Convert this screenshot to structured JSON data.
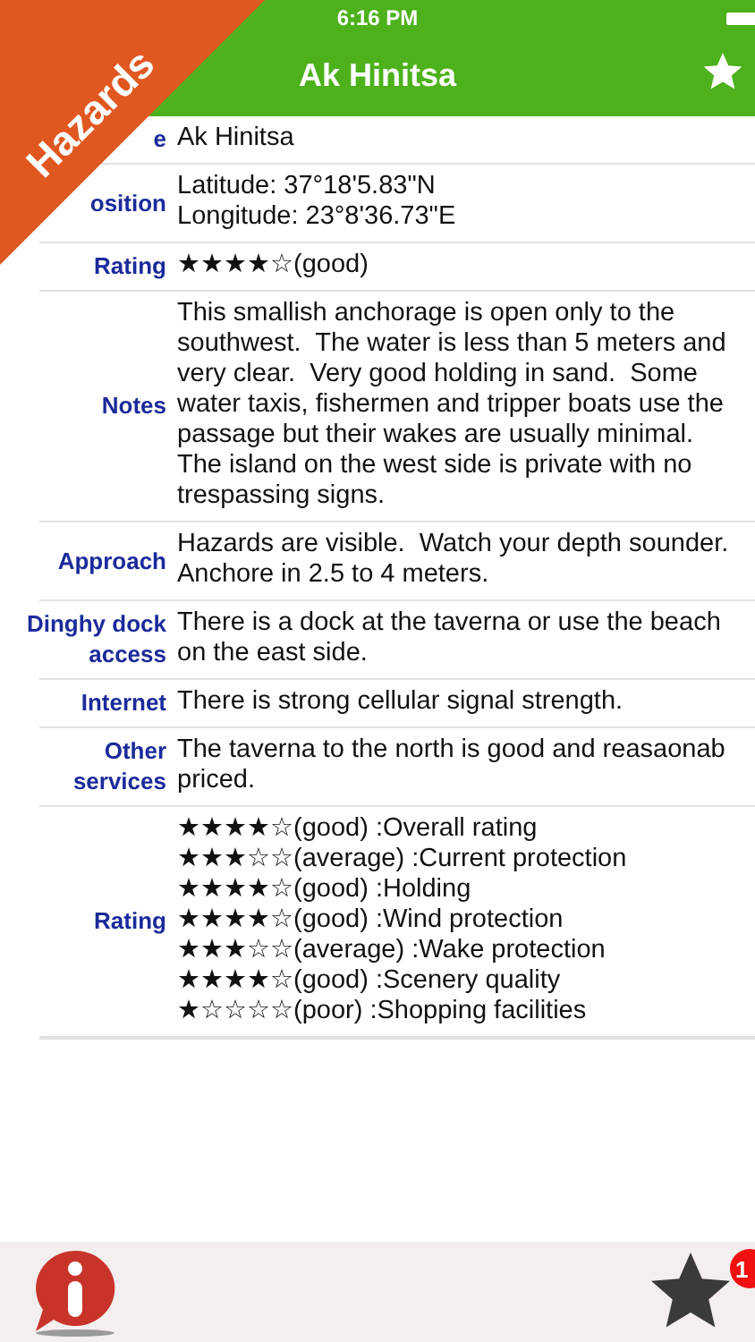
{
  "ribbon": {
    "label": "Hazards"
  },
  "status_bar": {
    "time": "6:16 PM"
  },
  "nav": {
    "title": "Ak Hinitsa"
  },
  "rows": [
    {
      "label": [
        "e"
      ],
      "lines": [
        "Ak Hinitsa"
      ]
    },
    {
      "label": [
        "osition"
      ],
      "lines": [
        "Latitude: 37°18'5.83\"N",
        "Longitude: 23°8'36.73\"E"
      ]
    },
    {
      "label": [
        "Rating"
      ],
      "lines": [
        "★★★★☆(good)"
      ]
    },
    {
      "label": [
        "Notes"
      ],
      "lines": [
        "This smallish anchorage is open only to the",
        "southwest.  The water is less than 5 meters and",
        "very clear.  Very good holding in sand.  Some",
        "water taxis, fishermen and tripper boats use the",
        "passage but their wakes are usually minimal.",
        "The island on the west side is private with no",
        "trespassing signs."
      ]
    },
    {
      "label": [
        "Approach"
      ],
      "lines": [
        "Hazards are visible.  Watch your depth sounder.",
        "Anchore in 2.5 to 4 meters."
      ]
    },
    {
      "label": [
        "Dinghy dock",
        "access"
      ],
      "lines": [
        "There is a dock at the taverna or use the beach",
        "on the east side."
      ]
    },
    {
      "label": [
        "Internet"
      ],
      "lines": [
        "There is strong cellular signal strength."
      ]
    },
    {
      "label": [
        "Other",
        "services"
      ],
      "lines": [
        "The taverna to the north is good and reasaonab",
        "priced."
      ]
    },
    {
      "label": [
        "Rating"
      ],
      "lines": [
        "★★★★☆(good) :Overall rating",
        "★★★☆☆(average) :Current protection",
        "★★★★☆(good) :Holding",
        "★★★★☆(good) :Wind protection",
        "★★★☆☆(average) :Wake protection",
        "★★★★☆(good) :Scenery quality",
        "★☆☆☆☆(poor) :Shopping facilities"
      ]
    }
  ],
  "toolbar": {
    "badge": "1"
  }
}
